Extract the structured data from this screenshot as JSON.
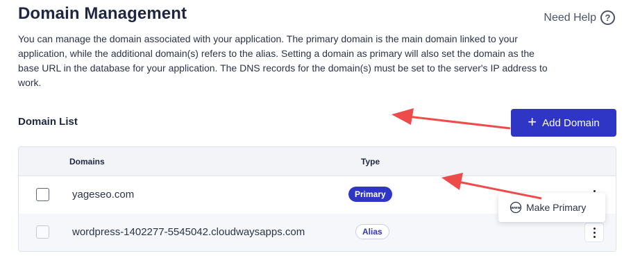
{
  "header": {
    "title": "Domain Management",
    "help_label": "Need Help",
    "help_icon_glyph": "?"
  },
  "description": "You can manage the domain associated with your application. The primary domain is the main domain linked to your application, while the additional domain(s) refers to the alias. Setting a domain as primary will also set the domain as the base URL in the database for your application. The DNS records for the domain(s) must be set to the server's IP address to work.",
  "domain_list": {
    "title": "Domain List",
    "add_button_label": "Add Domain",
    "add_button_icon": "plus-icon",
    "columns": [
      "Domains",
      "Type"
    ],
    "rows": [
      {
        "domain": "yageseo.com",
        "type": "Primary"
      },
      {
        "domain": "wordpress-1402277-5545042.cloudwaysapps.com",
        "type": "Alias"
      }
    ]
  },
  "context_menu": {
    "item_label": "Make Primary",
    "item_icon": "www-icon"
  },
  "colors": {
    "accent": "#2f35c4",
    "annotation_arrow": "#ee4b4b",
    "text": "#1e2640"
  }
}
